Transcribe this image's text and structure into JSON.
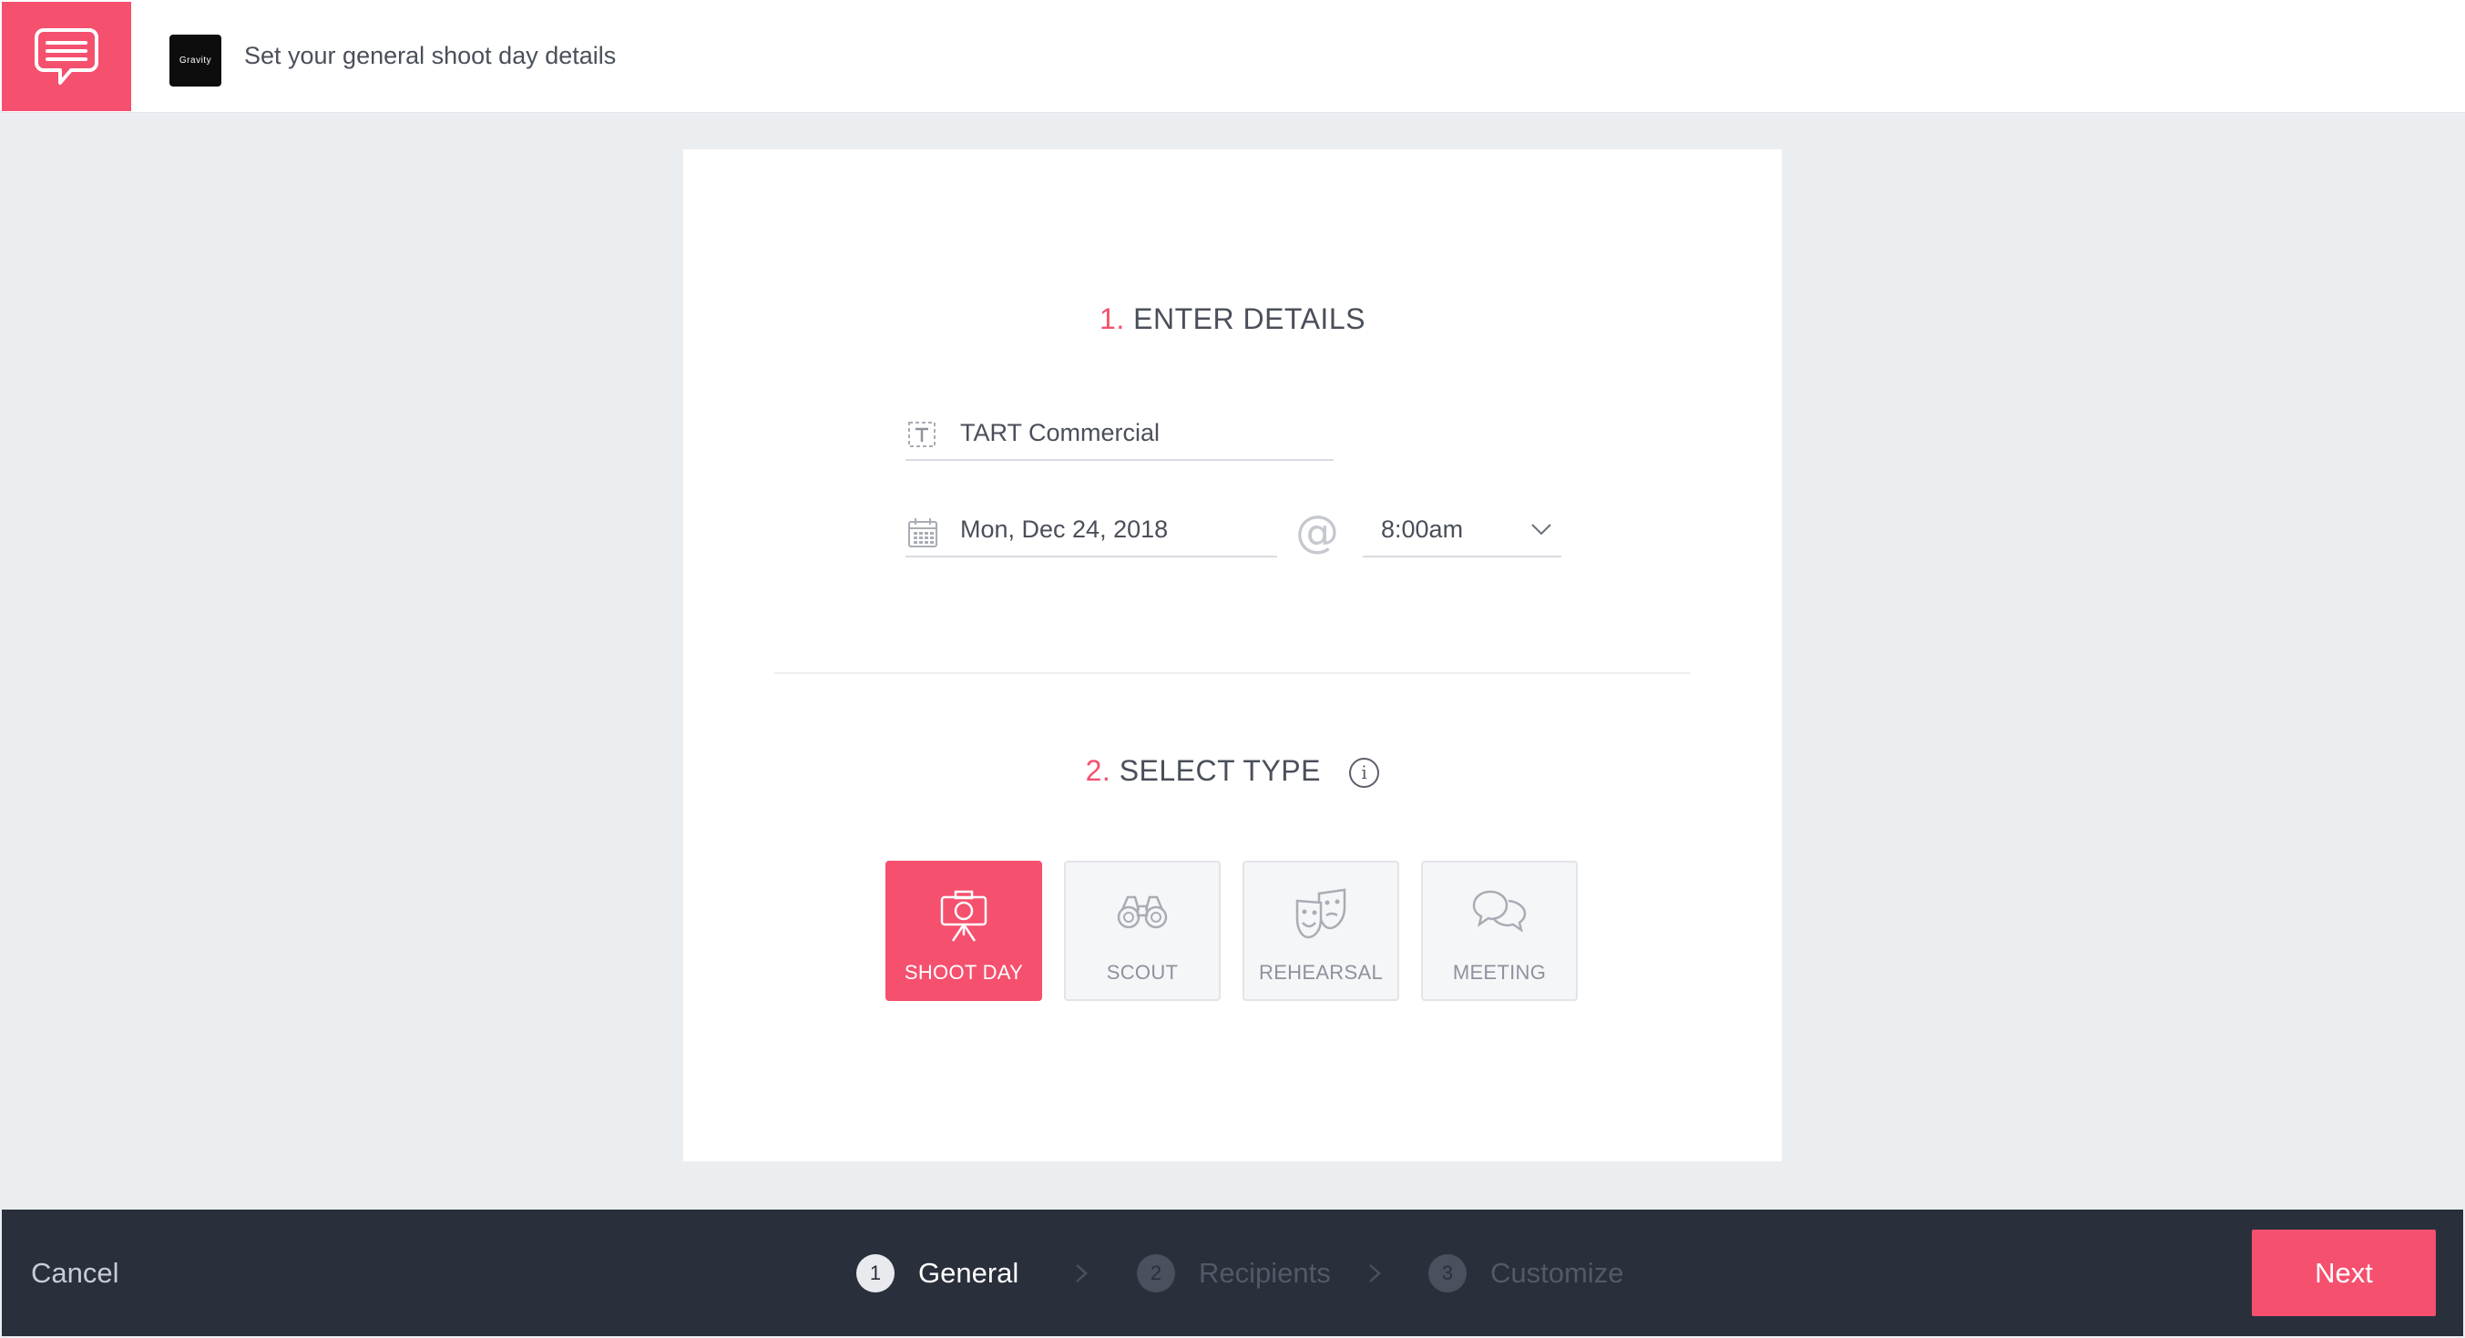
{
  "header": {
    "app_icon": "chat-bubble-icon",
    "project_logo_text": "Gravity",
    "title": "Set your general shoot day details"
  },
  "details": {
    "section_number": "1.",
    "section_title": "ENTER DETAILS",
    "name_value": "TART Commercial",
    "date_value": "Mon, Dec 24, 2018",
    "at_symbol": "@",
    "time_value": "8:00am"
  },
  "type": {
    "section_number": "2.",
    "section_title": "SELECT TYPE",
    "info_symbol": "i",
    "options": [
      {
        "label": "SHOOT DAY",
        "icon": "camera-tripod-icon",
        "selected": true
      },
      {
        "label": "SCOUT",
        "icon": "binoculars-icon",
        "selected": false
      },
      {
        "label": "REHEARSAL",
        "icon": "theater-masks-icon",
        "selected": false
      },
      {
        "label": "MEETING",
        "icon": "speech-bubbles-icon",
        "selected": false
      }
    ]
  },
  "footer": {
    "cancel_label": "Cancel",
    "steps": [
      {
        "number": "1",
        "label": "General",
        "active": true
      },
      {
        "number": "2",
        "label": "Recipients",
        "active": false
      },
      {
        "number": "3",
        "label": "Customize",
        "active": false
      }
    ],
    "next_label": "Next"
  },
  "colors": {
    "accent": "#f5506e",
    "footer_bg": "#2a2f3c",
    "page_bg": "#ebeef1"
  }
}
